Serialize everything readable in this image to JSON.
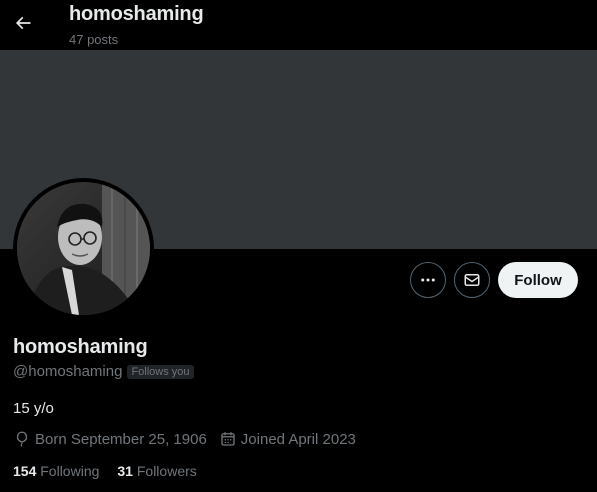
{
  "header": {
    "title": "homoshaming",
    "posts_count": "47 posts"
  },
  "profile": {
    "display_name": "homoshaming",
    "handle": "@homoshaming",
    "follows_you_badge": "Follows you",
    "bio": "15 y/o",
    "born": "Born September 25, 1906",
    "joined": "Joined April 2023",
    "following_count": "154",
    "following_label": "Following",
    "followers_count": "31",
    "followers_label": "Followers"
  },
  "actions": {
    "follow_label": "Follow",
    "more_icon": "more-icon",
    "message_icon": "envelope-icon"
  },
  "colors": {
    "background": "#000000",
    "banner": "#333639",
    "muted_text": "#71767b",
    "primary_text": "#e7e9ea",
    "follow_button_bg": "#eff3f4"
  }
}
